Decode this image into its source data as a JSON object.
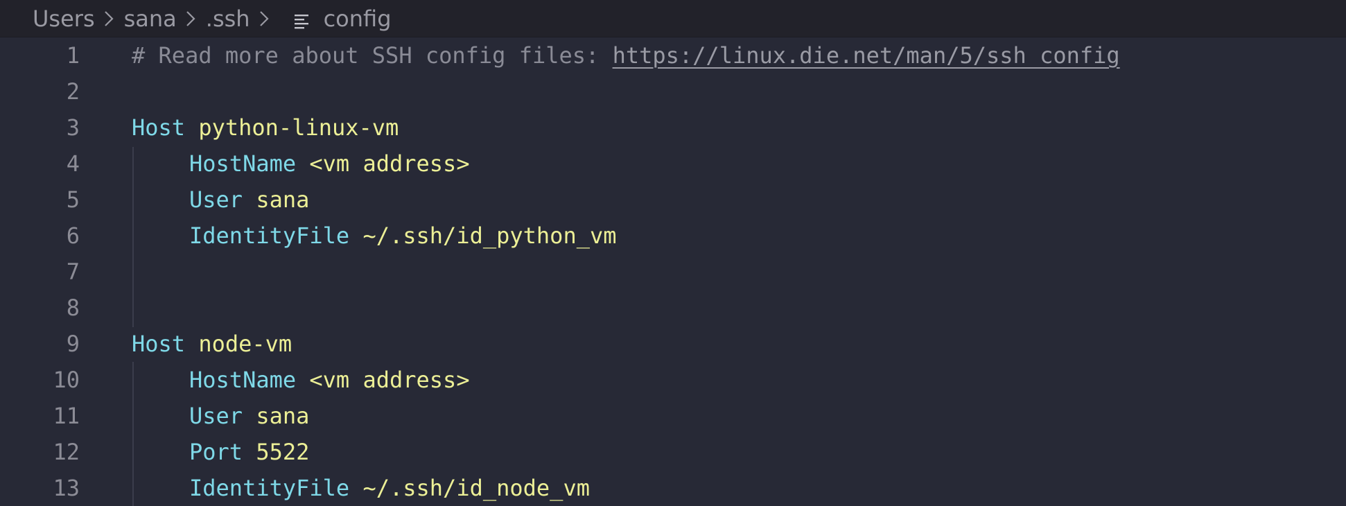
{
  "breadcrumb": {
    "items": [
      "Users",
      "sana",
      ".ssh"
    ],
    "file": "config"
  },
  "editor": {
    "lines": [
      {
        "num": "1",
        "comment": "# Read more about SSH config files: ",
        "link": "https://linux.die.net/man/5/ssh_config"
      },
      {
        "num": "2"
      },
      {
        "num": "3",
        "key": "Host",
        "value": "python-linux-vm"
      },
      {
        "num": "4",
        "key": "HostName",
        "value": "<vm address>"
      },
      {
        "num": "5",
        "key": "User",
        "value": "sana"
      },
      {
        "num": "6",
        "key": "IdentityFile",
        "value": "~/.ssh/id_python_vm"
      },
      {
        "num": "7"
      },
      {
        "num": "8"
      },
      {
        "num": "9",
        "key": "Host",
        "value": "node-vm"
      },
      {
        "num": "10",
        "key": "HostName",
        "value": "<vm address>"
      },
      {
        "num": "11",
        "key": "User",
        "value": "sana"
      },
      {
        "num": "12",
        "key": "Port",
        "value": "5522"
      },
      {
        "num": "13",
        "key": "IdentityFile",
        "value": "~/.ssh/id_node_vm"
      }
    ]
  },
  "colors": {
    "background": "#272936",
    "keyword": "#7fd9e8",
    "value": "#ecef96",
    "comment": "#8a8b96"
  }
}
